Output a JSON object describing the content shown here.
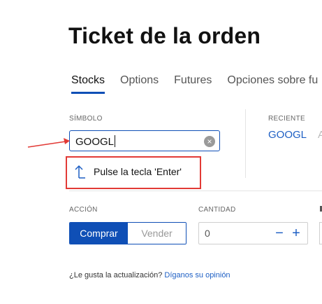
{
  "page": {
    "title": "Ticket de la orden"
  },
  "tabs": [
    {
      "label": "Stocks",
      "active": true
    },
    {
      "label": "Options",
      "active": false
    },
    {
      "label": "Futures",
      "active": false
    },
    {
      "label": "Opciones sobre fu",
      "active": false
    }
  ],
  "symbol": {
    "label": "SÍMBOLO",
    "value": "GOOGL",
    "clear_icon": "×"
  },
  "suggestion": {
    "text": "Pulse la tecla 'Enter'",
    "icon": "enter-arrow-icon"
  },
  "recent": {
    "label": "RECIENTE",
    "items": [
      "GOOGL",
      "A"
    ]
  },
  "action": {
    "label": "ACCIÓN",
    "buy_label": "Comprar",
    "sell_label": "Vender"
  },
  "quantity": {
    "label": "CANTIDAD",
    "value": "0",
    "minus": "−",
    "plus": "+"
  },
  "feedback": {
    "question": "¿Le gusta la actualización?",
    "link": "Díganos su opinión"
  },
  "colors": {
    "accent": "#0f4fb6",
    "link": "#1d5fc4",
    "annotation": "#e23a36"
  }
}
